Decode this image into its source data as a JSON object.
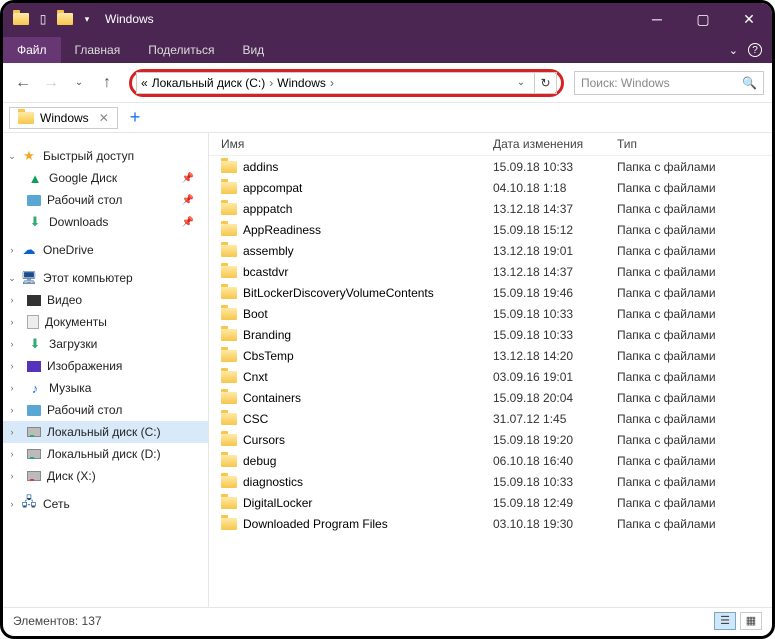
{
  "window": {
    "title": "Windows"
  },
  "ribbon": {
    "file": "Файл",
    "tabs": [
      "Главная",
      "Поделиться",
      "Вид"
    ]
  },
  "address": {
    "prefix": "«",
    "crumbs": [
      "Локальный диск (C:)",
      "Windows"
    ]
  },
  "search": {
    "placeholder": "Поиск: Windows"
  },
  "file_tab": {
    "label": "Windows"
  },
  "sidebar": {
    "quick": "Быстрый доступ",
    "quick_items": [
      {
        "label": "Google Диск",
        "icon": "gdrive",
        "pinned": true
      },
      {
        "label": "Рабочий стол",
        "icon": "desk",
        "pinned": true
      },
      {
        "label": "Downloads",
        "icon": "dl",
        "pinned": true
      }
    ],
    "onedrive": "OneDrive",
    "thispc": "Этот компьютер",
    "pc_items": [
      {
        "label": "Видео",
        "icon": "vid"
      },
      {
        "label": "Документы",
        "icon": "doc"
      },
      {
        "label": "Загрузки",
        "icon": "dl"
      },
      {
        "label": "Изображения",
        "icon": "pic"
      },
      {
        "label": "Музыка",
        "icon": "mus"
      },
      {
        "label": "Рабочий стол",
        "icon": "desk"
      },
      {
        "label": "Локальный диск (C:)",
        "icon": "hdd",
        "selected": true
      },
      {
        "label": "Локальный диск (D:)",
        "icon": "hdd d"
      },
      {
        "label": "Диск (X:)",
        "icon": "hdd x"
      }
    ],
    "network": "Сеть"
  },
  "columns": {
    "name": "Имя",
    "date": "Дата изменения",
    "type": "Тип"
  },
  "type_folder": "Папка с файлами",
  "files": [
    {
      "name": "addins",
      "date": "15.09.18 10:33"
    },
    {
      "name": "appcompat",
      "date": "04.10.18 1:18"
    },
    {
      "name": "apppatch",
      "date": "13.12.18 14:37"
    },
    {
      "name": "AppReadiness",
      "date": "15.09.18 15:12"
    },
    {
      "name": "assembly",
      "date": "13.12.18 19:01"
    },
    {
      "name": "bcastdvr",
      "date": "13.12.18 14:37"
    },
    {
      "name": "BitLockerDiscoveryVolumeContents",
      "date": "15.09.18 19:46"
    },
    {
      "name": "Boot",
      "date": "15.09.18 10:33"
    },
    {
      "name": "Branding",
      "date": "15.09.18 10:33"
    },
    {
      "name": "CbsTemp",
      "date": "13.12.18 14:20"
    },
    {
      "name": "Cnxt",
      "date": "03.09.16 19:01"
    },
    {
      "name": "Containers",
      "date": "15.09.18 20:04"
    },
    {
      "name": "CSC",
      "date": "31.07.12 1:45"
    },
    {
      "name": "Cursors",
      "date": "15.09.18 19:20"
    },
    {
      "name": "debug",
      "date": "06.10.18 16:40"
    },
    {
      "name": "diagnostics",
      "date": "15.09.18 10:33"
    },
    {
      "name": "DigitalLocker",
      "date": "15.09.18 12:49"
    },
    {
      "name": "Downloaded Program Files",
      "date": "03.10.18 19:30"
    }
  ],
  "status": {
    "count_label": "Элементов:",
    "count": "137"
  }
}
